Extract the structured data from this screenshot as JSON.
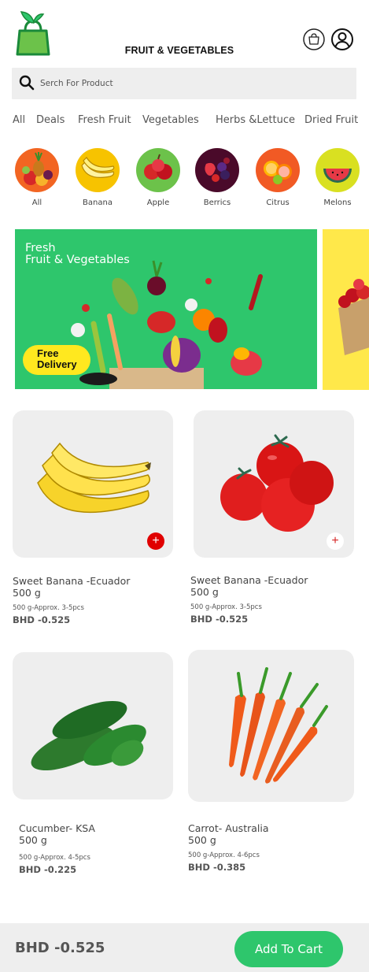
{
  "header": {
    "title": "FRUIT & VEGETABLES",
    "logo_icon": "grocery-bag-logo-icon",
    "cart_icon": "shopping-bag-icon",
    "user_icon": "user-profile-icon"
  },
  "search": {
    "placeholder": "Serch For Product",
    "icon": "search-icon"
  },
  "tabs": [
    "All",
    "Deals",
    "Fresh Fruit",
    "Vegetables",
    "Herbs &Lettuce",
    "Dried Fruit"
  ],
  "categories": [
    {
      "label": "All",
      "color": "#f26522"
    },
    {
      "label": "Banana",
      "color": "#f7c300"
    },
    {
      "label": "Apple",
      "color": "#6cc24a"
    },
    {
      "label": "Berrics",
      "color": "#4a0a2a"
    },
    {
      "label": "Citrus",
      "color": "#f15a24"
    },
    {
      "label": "Melons",
      "color": "#d9e021"
    }
  ],
  "banner": {
    "line1": "Fresh",
    "line2": "Fruit & Vegetables",
    "badge_line1": "Free",
    "badge_line2": "Delivery",
    "background": "#2ec66c",
    "badge_color": "#ffe81f"
  },
  "products": [
    {
      "name": "Sweet Banana -Ecuador",
      "weight": "500 g",
      "desc": "500 g-Approx. 3-5pcs",
      "price": "BHD -0.525",
      "image": "banana-image",
      "added": true
    },
    {
      "name": "Sweet Banana -Ecuador",
      "weight": "500 g",
      "desc": "500 g-Approx. 3-5pcs",
      "price": "BHD -0.525",
      "image": "tomato-image",
      "added": false
    },
    {
      "name": "Cucumber- KSA",
      "weight": "500 g",
      "desc": "500 g-Approx. 4-5pcs",
      "price": "BHD -0.225",
      "image": "cucumber-image",
      "added": false
    },
    {
      "name": "Carrot- Australia",
      "weight": "500 g",
      "desc": "500 g-Approx. 4-6pcs",
      "price": "BHD -0.385",
      "image": "carrot-image",
      "added": false
    }
  ],
  "bottom": {
    "total": "BHD -0.525",
    "button": "Add To Cart",
    "accent": "#2ec66c"
  }
}
